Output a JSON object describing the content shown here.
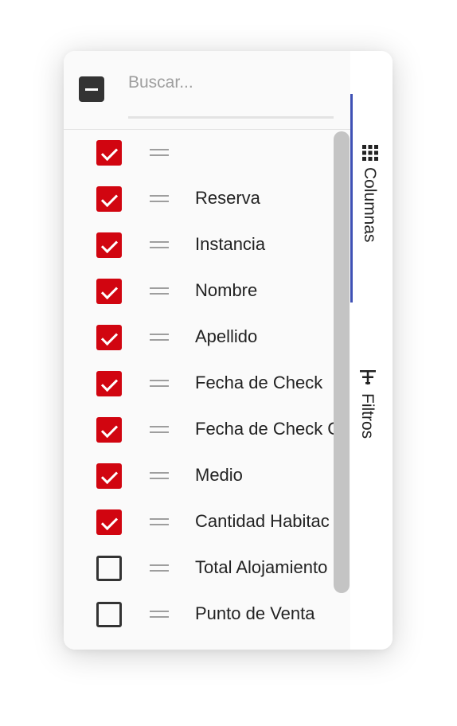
{
  "header": {
    "select_all_state": "indeterminate",
    "search_placeholder": "Buscar..."
  },
  "columns": [
    {
      "label": "",
      "checked": true
    },
    {
      "label": "Reserva",
      "checked": true
    },
    {
      "label": "Instancia",
      "checked": true
    },
    {
      "label": "Nombre",
      "checked": true
    },
    {
      "label": "Apellido",
      "checked": true
    },
    {
      "label": "Fecha de Check",
      "checked": true
    },
    {
      "label": "Fecha de Check C",
      "checked": true
    },
    {
      "label": "Medio",
      "checked": true
    },
    {
      "label": "Cantidad Habitac",
      "checked": true
    },
    {
      "label": "Total Alojamiento",
      "checked": false
    },
    {
      "label": "Punto de Venta",
      "checked": false
    }
  ],
  "side_tabs": {
    "columns_label": "Columnas",
    "columns_icon": "grid-icon",
    "filters_label": "Filtros",
    "filters_icon": "filter-icon"
  },
  "colors": {
    "checkbox_checked": "#d10510",
    "active_tab_accent": "#3f51b5",
    "select_all_bg": "#333333"
  }
}
